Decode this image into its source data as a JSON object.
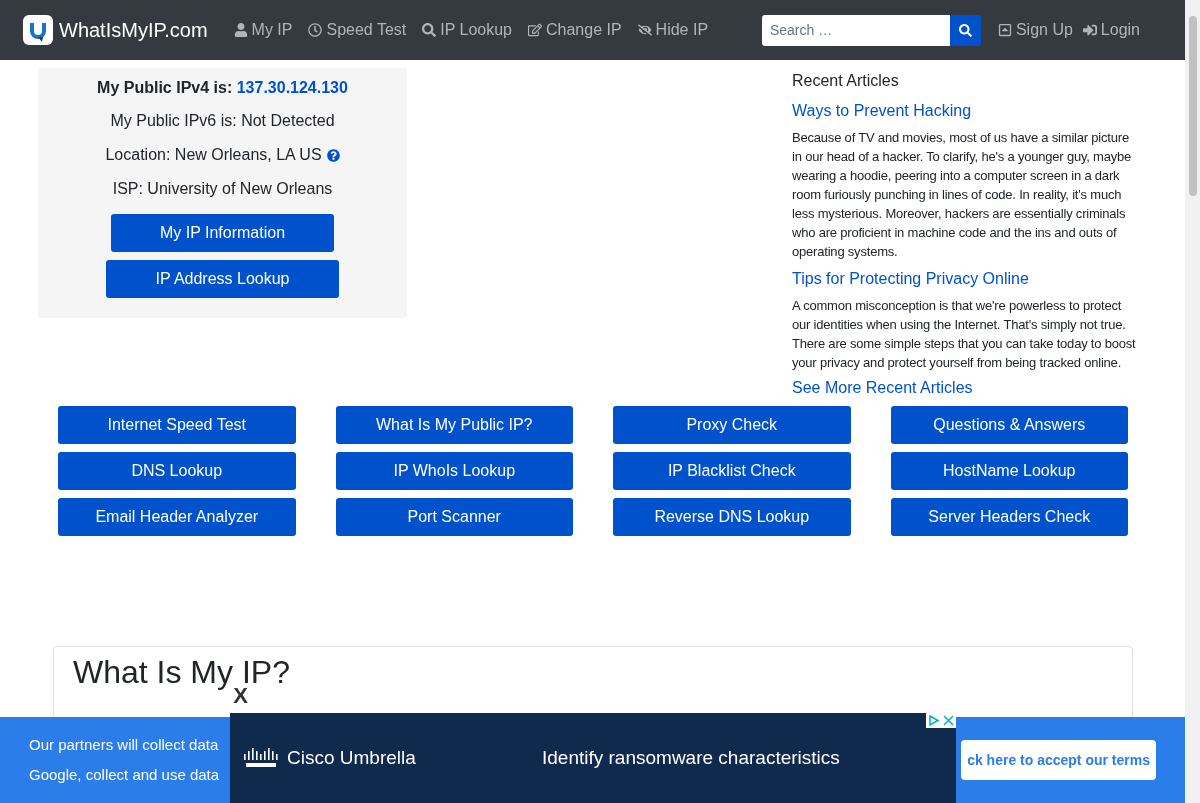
{
  "navbar": {
    "brand": "WhatIsMyIP.com",
    "links": [
      {
        "label": "My IP"
      },
      {
        "label": "Speed Test"
      },
      {
        "label": "IP Lookup"
      },
      {
        "label": "Change IP"
      },
      {
        "label": "Hide IP"
      }
    ],
    "search": {
      "placeholder": "Search …"
    },
    "account": [
      {
        "label": "Sign Up"
      },
      {
        "label": "Login"
      }
    ]
  },
  "ip_card": {
    "ipv4_label": "My Public IPv4 is:",
    "ipv4": "137.30.124.130",
    "ipv6": "My Public IPv6 is: Not Detected",
    "location": "Location: New Orleans, LA US",
    "isp": "ISP: University of New Orleans",
    "buttons": [
      "My IP Information",
      "IP Address Lookup"
    ]
  },
  "recent_articles": {
    "title": "Recent Articles",
    "articles": [
      {
        "title": "Ways to Prevent Hacking",
        "text": "Because of TV and movies, most of us have a similar picture in our head of a hacker. To clarify, he's a younger guy, maybe wearing a hoodie, peering into a computer screen in a dark room furiously punching in lines of code. In reality, it's much less mysterious. Moreover, hackers are essentially criminals who are proficient in machine code and the ins and outs of operating systems."
      },
      {
        "title": "Tips for Protecting Privacy Online",
        "text": "A common misconception is that we're powerless to protect our identities when using the Internet. That's simply not true. There are some simple steps that you can take today to boost your privacy and protect yourself from being tracked online."
      }
    ],
    "more": "See More Recent Articles"
  },
  "tools": [
    "Internet Speed Test",
    "What Is My Public IP?",
    "Proxy Check",
    "Questions & Answers",
    "DNS Lookup",
    "IP WhoIs Lookup",
    "IP Blacklist Check",
    "HostName Lookup",
    "Email Header Analyzer",
    "Port Scanner",
    "Reverse DNS Lookup",
    "Server Headers Check"
  ],
  "section": {
    "heading": "What Is My IP?"
  },
  "consent": {
    "lines": [
      "Our partners will collect data",
      "Google, collect and use data"
    ],
    "button": "ck here to accept our terms"
  },
  "ad": {
    "close": "X",
    "brand": "Cisco Umbrella",
    "text": "Identify ransomware characteristics"
  }
}
